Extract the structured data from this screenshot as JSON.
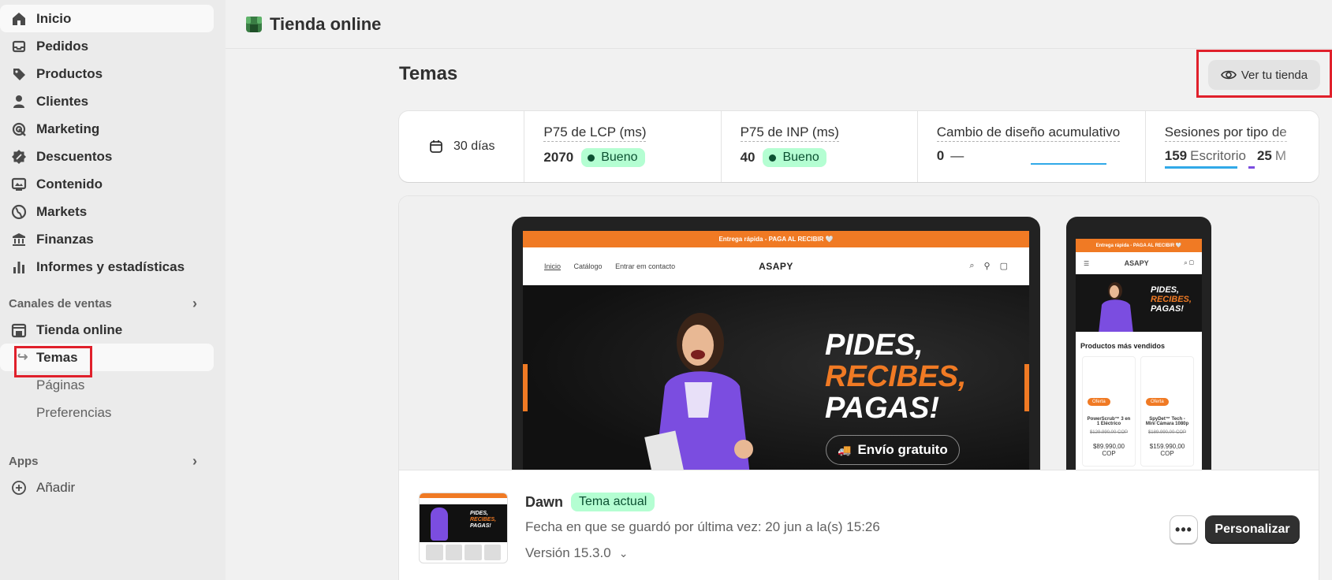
{
  "sidebar": {
    "items": [
      {
        "label": "Inicio",
        "icon": "home-icon"
      },
      {
        "label": "Pedidos",
        "icon": "inbox-icon"
      },
      {
        "label": "Productos",
        "icon": "tag-icon"
      },
      {
        "label": "Clientes",
        "icon": "person-icon"
      },
      {
        "label": "Marketing",
        "icon": "target-icon"
      },
      {
        "label": "Descuentos",
        "icon": "discount-icon"
      },
      {
        "label": "Contenido",
        "icon": "content-icon"
      },
      {
        "label": "Markets",
        "icon": "globe-icon"
      },
      {
        "label": "Finanzas",
        "icon": "bank-icon"
      },
      {
        "label": "Informes y estadísticas",
        "icon": "chart-icon"
      }
    ],
    "sales_channels_heading": "Canales de ventas",
    "online_store": "Tienda online",
    "sub_items": [
      "Temas",
      "Páginas",
      "Preferencias"
    ],
    "apps_heading": "Apps",
    "add_label": "Añadir"
  },
  "topbar": {
    "title": "Tienda online"
  },
  "page": {
    "title": "Temas",
    "view_store_label": "Ver tu tienda"
  },
  "metrics": {
    "date_range": "30 días",
    "lcp": {
      "label": "P75 de LCP (ms)",
      "value": "2070",
      "status": "Bueno"
    },
    "inp": {
      "label": "P75 de INP (ms)",
      "value": "40",
      "status": "Bueno"
    },
    "cls": {
      "label": "Cambio de diseño acumulativo",
      "value": "0",
      "dash": "—"
    },
    "sessions": {
      "label": "Sesiones por tipo de",
      "desktop_value": "159",
      "desktop_label": "Escritorio",
      "mobile_value": "25",
      "mobile_label": "M"
    }
  },
  "preview": {
    "announcement": "Entrega rápida - PAGA AL RECIBIR 🤍",
    "nav_links": [
      "Inicio",
      "Catálogo",
      "Entrar em contacto"
    ],
    "brand": "ASAPY",
    "hero_line1": "PIDES,",
    "hero_line2": "RECIBES,",
    "hero_line3": "PAGAS!",
    "shipping_button": "Envío gratuito",
    "mobile_section_title": "Productos más vendidos",
    "mobile_products": [
      {
        "badge": "Oferta",
        "name": "PowerScrub™ 3 en 1 Eléctrico",
        "old_price": "$129.990,00 COP",
        "price": "$89.990,00 COP"
      },
      {
        "badge": "Oferta",
        "name": "SpyDet™ Tech - Mini Cámara 1080p",
        "old_price": "$189.990,00 COP",
        "price": "$159.990,00 COP"
      }
    ]
  },
  "theme": {
    "name": "Dawn",
    "badge": "Tema actual",
    "saved": "Fecha en que se guardó por última vez: 20 jun a la(s) 15:26",
    "version": "Versión 15.3.0",
    "more_label": "•••",
    "customize_label": "Personalizar"
  }
}
